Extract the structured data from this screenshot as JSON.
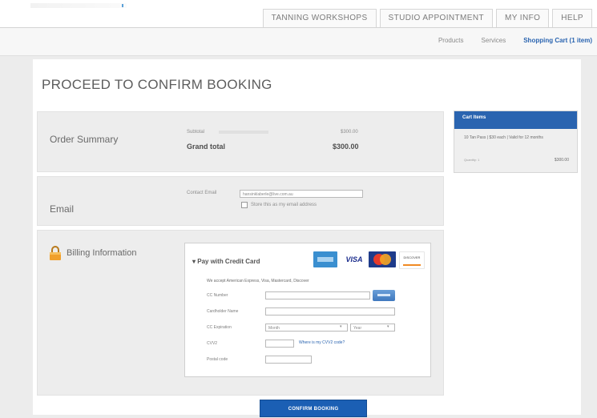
{
  "top_nav": {
    "tabs": [
      "TANNING WORKSHOPS",
      "STUDIO APPOINTMENT",
      "MY INFO",
      "HELP"
    ]
  },
  "sub_nav": {
    "links": [
      "Products",
      "Services",
      "Shopping Cart (1 item)"
    ]
  },
  "page": {
    "title": "PROCEED TO CONFIRM BOOKING"
  },
  "order_summary": {
    "label": "Order Summary",
    "line_label": "Subtotal",
    "line_value": "$300.00",
    "grand_label": "Grand total",
    "grand_value": "$300.00"
  },
  "email": {
    "label": "Email",
    "field_label": "Contact Email",
    "field_value": "hansinklaberle@live.com.au",
    "checkbox_label": "Store this as my email address"
  },
  "billing": {
    "label": "Billing Information",
    "pay_title": "Pay with Credit Card",
    "accept_text": "We accept American Express, Visa, Mastercard, Discover",
    "cards": [
      "AMEX",
      "VISA",
      "MasterCard",
      "DISCOVER"
    ],
    "fields": {
      "cc_number_label": "CC Number",
      "cardholder_label": "Cardholder Name",
      "expiration_label": "CC Expiration",
      "month_value": "Month",
      "year_value": "Year",
      "cvv_label": "CVV2",
      "cvv_link": "Where is my CVV2 code?",
      "postal_label": "Postal code"
    }
  },
  "cart": {
    "header": "Cart Items",
    "item_text": "10 Tan Pass | $30 each | Valid for 12 months",
    "qty_text": "Quantity: 1",
    "price": "$300.00"
  },
  "actions": {
    "confirm_label": "CONFIRM BOOKING"
  },
  "colors": {
    "accent": "#2a64b0",
    "section_bg": "#ededed",
    "confirm_bg": "#1b5fb4"
  }
}
